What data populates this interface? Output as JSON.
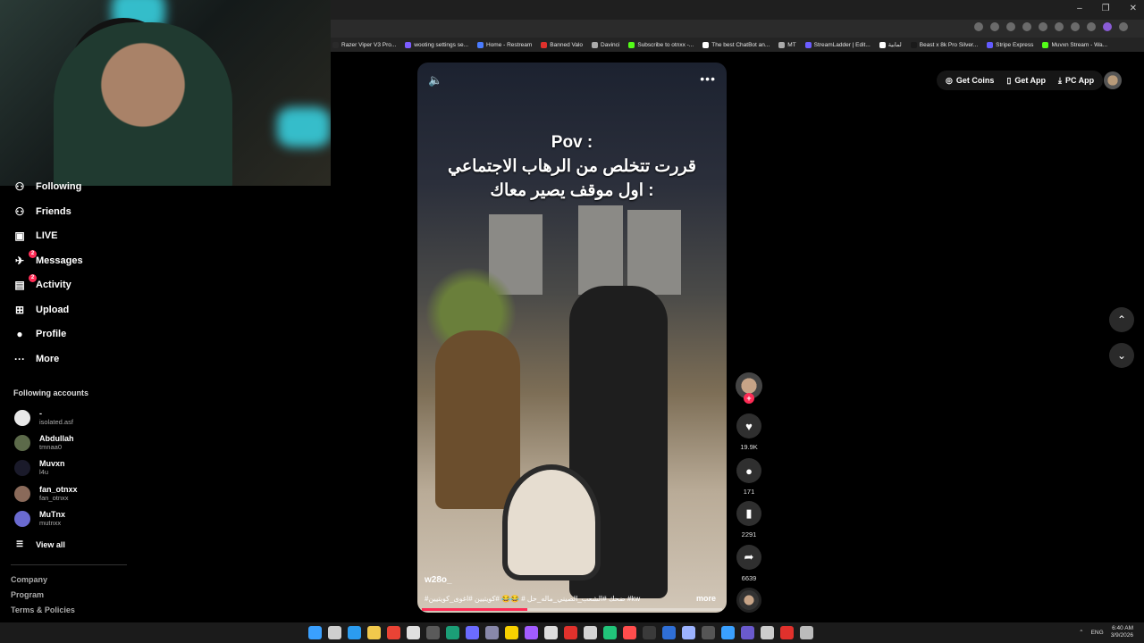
{
  "browser": {
    "window_controls": [
      "–",
      "❐",
      "✕"
    ],
    "bookmarks": [
      {
        "label": "Razer Viper V3 Pro...",
        "color": "#2a2a2a"
      },
      {
        "label": "wooting settings se...",
        "color": "#7c5cff"
      },
      {
        "label": "Home - Restream",
        "color": "#4a7cff"
      },
      {
        "label": "Banned Valo",
        "color": "#e0312c"
      },
      {
        "label": "Davinci",
        "color": "#aaaaaa"
      },
      {
        "label": "Subscribe to otnxx -...",
        "color": "#53fc18"
      },
      {
        "label": "The best ChatBot an...",
        "color": "#ffffff"
      },
      {
        "label": "MT",
        "color": "#aaaaaa"
      },
      {
        "label": "StreamLadder | Edit...",
        "color": "#6b5cff"
      },
      {
        "label": "لمابية",
        "color": "#ffffff"
      },
      {
        "label": "Beast x 8k Pro Silver...",
        "color": "#1a1a1a"
      },
      {
        "label": "Stripe Express",
        "color": "#635bff"
      },
      {
        "label": "Muvxn Stream - Wa...",
        "color": "#53fc18"
      }
    ]
  },
  "sidebar": {
    "items": [
      {
        "label": "Following",
        "icon": "following-icon",
        "glyph": "⚇"
      },
      {
        "label": "Friends",
        "icon": "friends-icon",
        "glyph": "⚇"
      },
      {
        "label": "LIVE",
        "icon": "live-icon",
        "glyph": "▣"
      },
      {
        "label": "Messages",
        "icon": "messages-icon",
        "glyph": "✈",
        "badge": "2"
      },
      {
        "label": "Activity",
        "icon": "activity-icon",
        "glyph": "▤",
        "badge": "2"
      },
      {
        "label": "Upload",
        "icon": "upload-icon",
        "glyph": "⊞"
      },
      {
        "label": "Profile",
        "icon": "profile-icon",
        "glyph": "●"
      },
      {
        "label": "More",
        "icon": "more-icon",
        "glyph": "···"
      }
    ],
    "following_title": "Following accounts",
    "accounts": [
      {
        "name": "-",
        "handle": "isolated.asf",
        "color": "#e8e8e8"
      },
      {
        "name": "Abdullah",
        "handle": "tmnaa0",
        "color": "#5c6a4a"
      },
      {
        "name": "Muvxn",
        "handle": "l4u",
        "color": "#1a1a2a"
      },
      {
        "name": "fan_otnxx",
        "handle": "fan_otnxx",
        "color": "#8a6a5a"
      },
      {
        "name": "MuTnx",
        "handle": "mutnxx",
        "color": "#6a6ad0"
      }
    ],
    "view_all": "View all",
    "footer": [
      "Company",
      "Program",
      "Terms & Policies"
    ]
  },
  "video": {
    "overlay_lines": [
      "Pov :",
      "قررت تتخلص من الرهاب الاجتماعي",
      "اول موقف يصير معاك :"
    ],
    "author": "w28o_",
    "caption": "#ضحك #الشعب_الصيني_ماله_حل # 😂😂 #كويتيين #اغوى_كويتيين #kw",
    "more_label": "more",
    "progress": 0.35
  },
  "actions": {
    "likes": "19.9K",
    "comments": "171",
    "saves": "2291",
    "shares": "6639"
  },
  "topbar": {
    "get_coins": "Get Coins",
    "get_app": "Get App",
    "pc_app": "PC App"
  },
  "taskbar": {
    "icon_colors": [
      "#3aa0ff",
      "#cfcfcf",
      "#2b9cf0",
      "#f2c94c",
      "#ea4335",
      "#e0e0e0",
      "#5a5a5a",
      "#1b9e77",
      "#6b6bff",
      "#8888aa",
      "#f7d000",
      "#a25cff",
      "#dddddd",
      "#e0312c",
      "#d3d3d3",
      "#21c47a",
      "#ff4d4d",
      "#3a3a3a",
      "#2f6fd6",
      "#9cb3ff",
      "#555555",
      "#3aa0ff",
      "#6a5acd",
      "#cccccc",
      "#e0312c",
      "#bbbbbb"
    ],
    "lang": "ENG",
    "time": "6:40 AM",
    "date": "3/9/2026"
  }
}
